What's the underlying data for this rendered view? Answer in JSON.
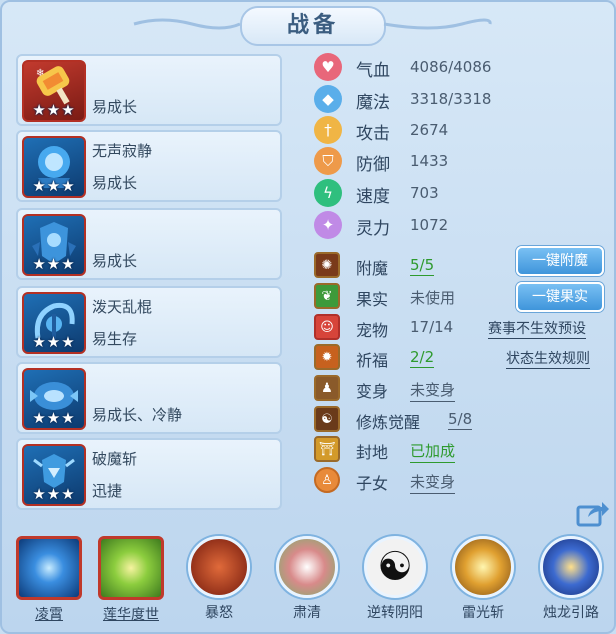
{
  "title": "战备",
  "skills": [
    {
      "name": "",
      "trait": "易成长",
      "stars": "★★★"
    },
    {
      "name": "无声寂静",
      "trait": "易成长",
      "stars": "★★★"
    },
    {
      "name": "",
      "trait": "易成长",
      "stars": "★★★"
    },
    {
      "name": "泼天乱棍",
      "trait": "易生存",
      "stars": "★★★"
    },
    {
      "name": "",
      "trait": "易成长、冷静",
      "stars": "★★★"
    },
    {
      "name": "破魔斩",
      "trait": "迅捷",
      "stars": "★★★"
    }
  ],
  "stats": [
    {
      "label": "气血",
      "value": "4086/4086",
      "color": "#e8677a",
      "icon": "heart-icon"
    },
    {
      "label": "魔法",
      "value": "3318/3318",
      "color": "#5aaeea",
      "icon": "water-drop-icon"
    },
    {
      "label": "攻击",
      "value": "2674",
      "color": "#f0b545",
      "icon": "sword-icon"
    },
    {
      "label": "防御",
      "value": "1433",
      "color": "#ee9a4a",
      "icon": "shield-icon"
    },
    {
      "label": "速度",
      "value": "703",
      "color": "#2fbf7e",
      "icon": "lightning-icon"
    },
    {
      "label": "灵力",
      "value": "1072",
      "color": "#c08ae6",
      "icon": "spirit-icon"
    }
  ],
  "info": {
    "enchant": {
      "label": "附魔",
      "value": "5/5",
      "button": "一键附魔"
    },
    "fruit": {
      "label": "果实",
      "value": "未使用",
      "button": "一键果实"
    },
    "pet": {
      "label": "宠物",
      "value": "17/14",
      "link": "赛事不生效预设"
    },
    "blessing": {
      "label": "祈福",
      "value": "2/2",
      "link": "状态生效规则"
    },
    "transform": {
      "label": "变身",
      "value": "未变身"
    },
    "awakening": {
      "label": "修炼觉醒",
      "value": "5/8"
    },
    "territory": {
      "label": "封地",
      "value": "已加成"
    },
    "children": {
      "label": "子女",
      "value": "未变身"
    }
  },
  "bottom_skills": [
    {
      "label": "凌霄",
      "selected": true
    },
    {
      "label": "莲华度世",
      "selected": true
    },
    {
      "label": "暴怒",
      "selected": false
    },
    {
      "label": "肃清",
      "selected": false
    },
    {
      "label": "逆转阴阳",
      "selected": false
    },
    {
      "label": "雷光斩",
      "selected": false
    },
    {
      "label": "烛龙引路",
      "selected": false
    }
  ]
}
